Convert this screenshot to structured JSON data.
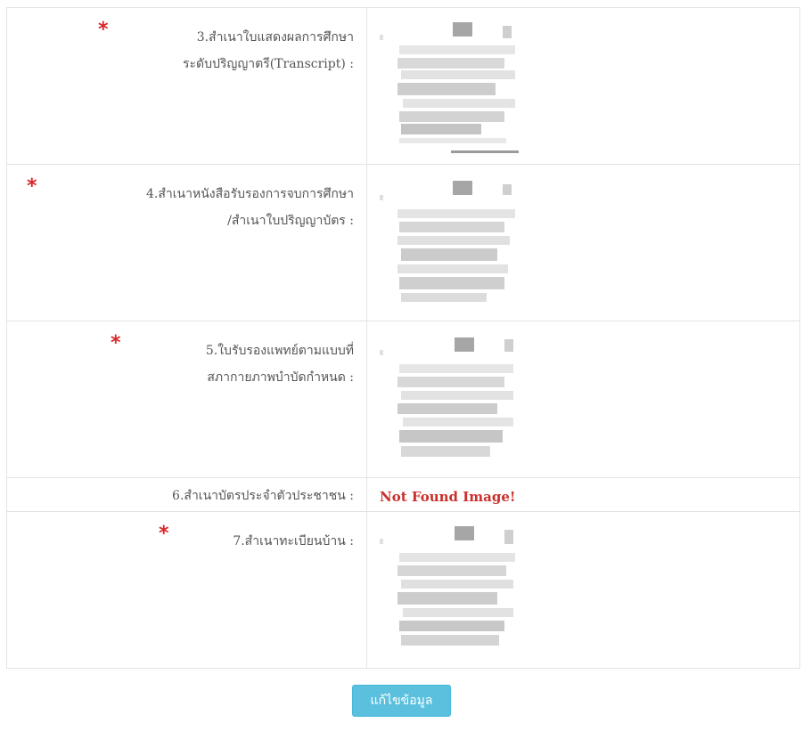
{
  "rows": [
    {
      "required": true,
      "label_line1": "3.สำเนาใบแสดงผลการศึกษา",
      "label_line2": "ระดับปริญญาตรี(Transcript) :"
    },
    {
      "required": true,
      "label_line1": "4.สำเนาหนังสือรับรองการจบการศึกษา",
      "label_line2": "/สำเนาใบปริญญาบัตร :"
    },
    {
      "required": true,
      "label_line1": "5.ใบรับรองแพทย์ตามแบบที่",
      "label_line2": "สภากายภาพบำบัดกำหนด :"
    },
    {
      "required": false,
      "label_line1": "6.สำเนาบัตรประจำตัวประชาชน :",
      "status_text": "Not Found Image!"
    },
    {
      "required": true,
      "label_line1": "7.สำเนาทะเบียนบ้าน :"
    }
  ],
  "required_mark": "*",
  "edit_button_label": "แก้ไขข้อมูล",
  "colors": {
    "required_star": "#d9262b",
    "not_found_text": "#c9302c",
    "button_bg": "#5bc0de"
  }
}
